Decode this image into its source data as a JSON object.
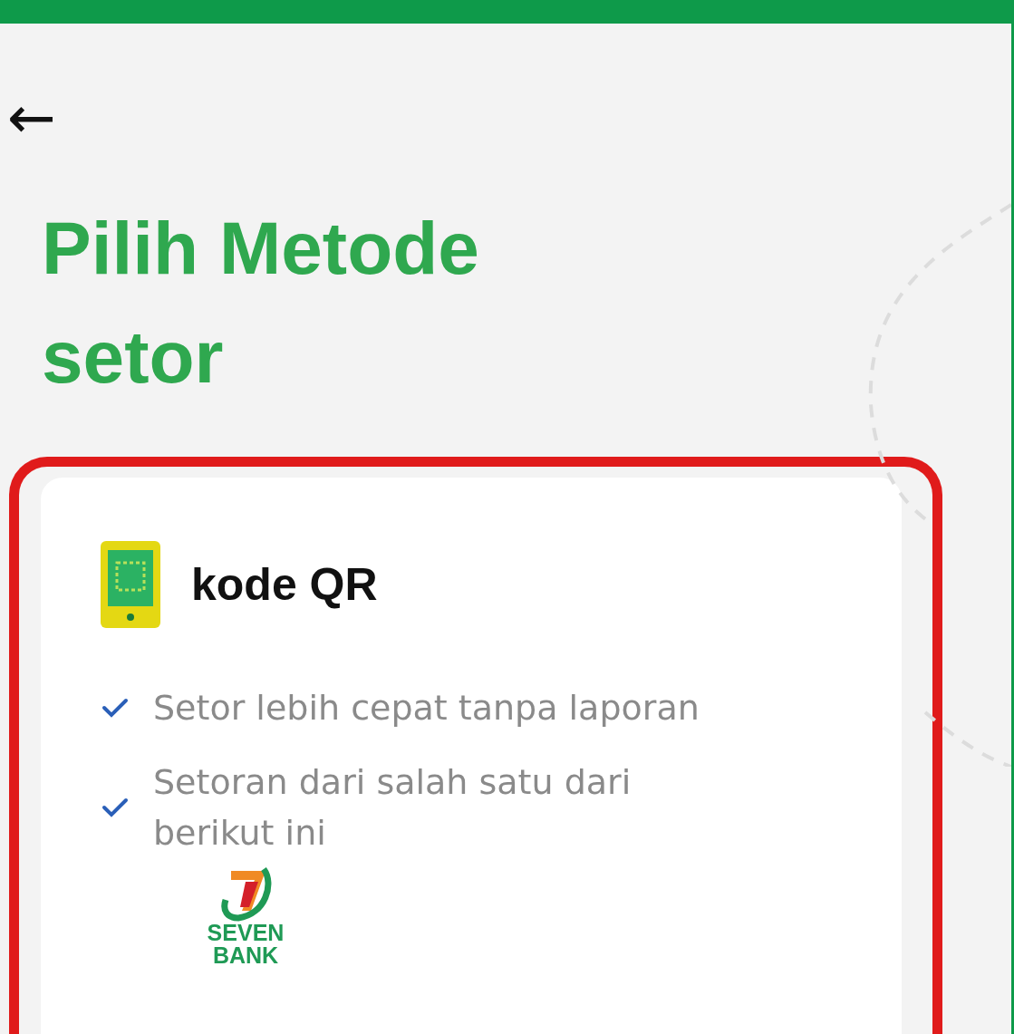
{
  "header": {
    "back": "←",
    "title": "Pilih Metode setor"
  },
  "methods": [
    {
      "name": "kode QR",
      "highlighted": true,
      "features": [
        {
          "text": "Setor lebih cepat tanpa laporan",
          "checked": true
        },
        {
          "text": "Setoran dari salah satu dari berikut ini",
          "checked": true
        }
      ],
      "partners": [
        {
          "name": "SEVEN BANK"
        }
      ]
    }
  ]
}
